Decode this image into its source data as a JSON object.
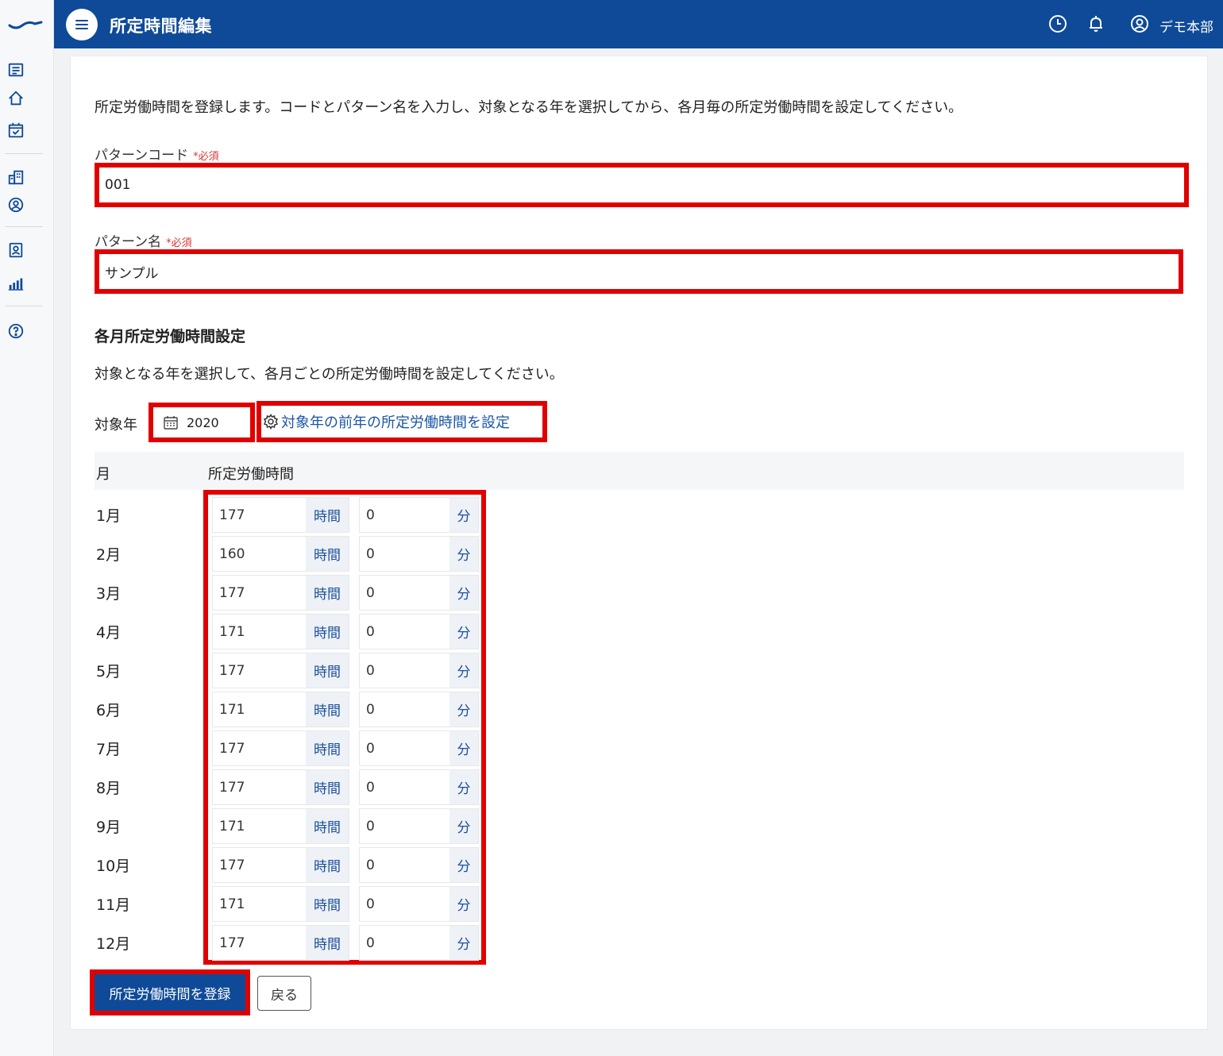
{
  "header": {
    "title": "所定時間編集",
    "user": "デモ本部"
  },
  "content": {
    "intro": "所定労働時間を登録します。コードとパターン名を入力し、対象となる年を選択してから、各月毎の所定労働時間を設定してください。",
    "code_label": "パターンコード",
    "name_label": "パターン名",
    "required": "*必須",
    "code_value": "001",
    "name_value": "サンプル",
    "section_title": "各月所定労働時間設定",
    "section_desc": "対象となる年を選択して、各月ごとの所定労働時間を設定してください。",
    "year_label": "対象年",
    "year_value": "2020",
    "prev_year_link": "対象年の前年の所定労働時間を設定",
    "col_month": "月",
    "col_hours": "所定労働時間",
    "unit_hours": "時間",
    "unit_minutes": "分",
    "submit_label": "所定労働時間を登録",
    "back_label": "戻る"
  },
  "months": [
    {
      "label": "1月",
      "hours": "177",
      "minutes": "0"
    },
    {
      "label": "2月",
      "hours": "160",
      "minutes": "0"
    },
    {
      "label": "3月",
      "hours": "177",
      "minutes": "0"
    },
    {
      "label": "4月",
      "hours": "171",
      "minutes": "0"
    },
    {
      "label": "5月",
      "hours": "177",
      "minutes": "0"
    },
    {
      "label": "6月",
      "hours": "171",
      "minutes": "0"
    },
    {
      "label": "7月",
      "hours": "177",
      "minutes": "0"
    },
    {
      "label": "8月",
      "hours": "177",
      "minutes": "0"
    },
    {
      "label": "9月",
      "hours": "171",
      "minutes": "0"
    },
    {
      "label": "10月",
      "hours": "177",
      "minutes": "0"
    },
    {
      "label": "11月",
      "hours": "171",
      "minutes": "0"
    },
    {
      "label": "12月",
      "hours": "177",
      "minutes": "0"
    }
  ],
  "colors": {
    "brand": "#0e4a98",
    "highlight": "#e00000",
    "link": "#1a56a8",
    "required": "#dd3333"
  },
  "icons": {
    "sidebar": [
      "list-icon",
      "home-icon",
      "calendar-check-icon",
      "building-icon",
      "user-circle-icon",
      "id-badge-icon",
      "bar-chart-icon",
      "help-icon"
    ],
    "header": [
      "clock-icon",
      "bell-icon",
      "account-icon"
    ]
  }
}
